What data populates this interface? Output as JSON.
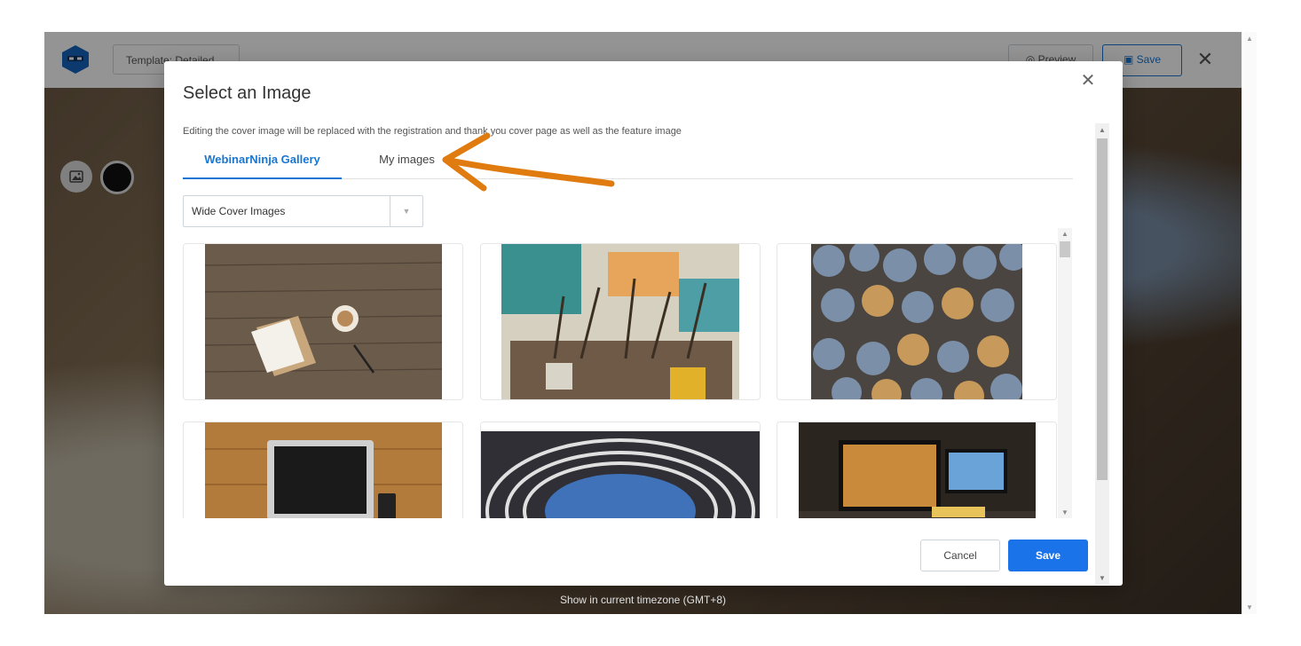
{
  "app": {
    "template_label": "Template: Detailed",
    "preview_label": "Preview",
    "save_label": "Save",
    "timezone_text": "Show in current timezone (GMT+8)"
  },
  "modal": {
    "title": "Select an Image",
    "description": "Editing the cover image will be replaced with the registration and thank you cover page as well as the feature image",
    "tabs": [
      {
        "label": "WebinarNinja Gallery",
        "active": true
      },
      {
        "label": "My images",
        "active": false
      }
    ],
    "category_select": {
      "value": "Wide Cover Images"
    },
    "buttons": {
      "cancel_label": "Cancel",
      "save_label": "Save"
    }
  },
  "colors": {
    "accent": "#1976d2",
    "primary_button": "#1a73e8",
    "annotation_arrow": "#e07b10"
  }
}
